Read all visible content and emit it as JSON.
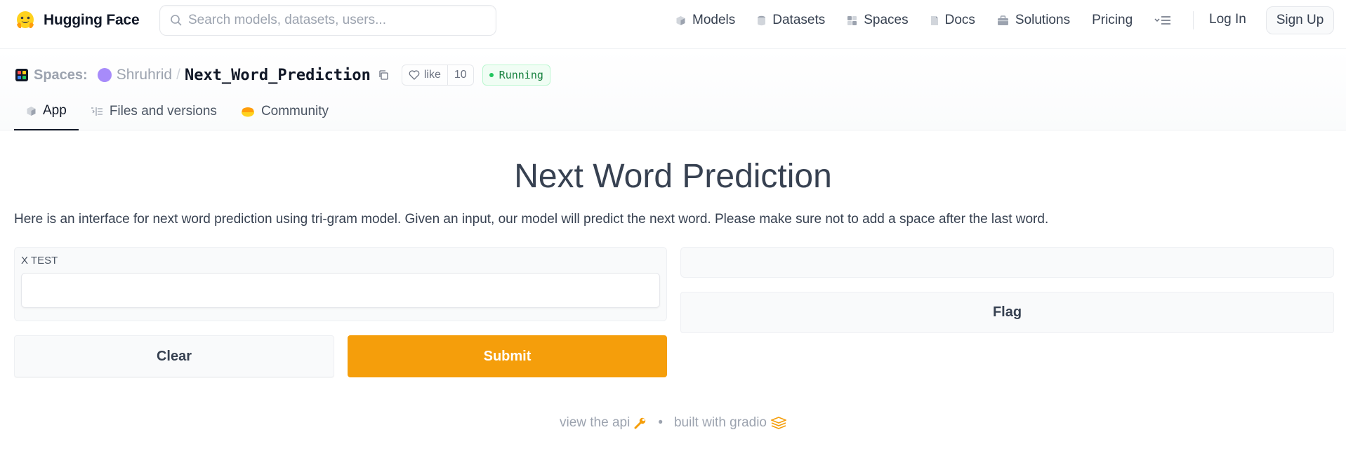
{
  "brand": {
    "name": "Hugging Face"
  },
  "search": {
    "placeholder": "Search models, datasets, users..."
  },
  "nav": {
    "items": [
      {
        "label": "Models",
        "icon": "cube-icon"
      },
      {
        "label": "Datasets",
        "icon": "database-icon"
      },
      {
        "label": "Spaces",
        "icon": "spaces-icon"
      },
      {
        "label": "Docs",
        "icon": "doc-icon"
      },
      {
        "label": "Solutions",
        "icon": "briefcase-icon"
      },
      {
        "label": "Pricing",
        "icon": ""
      }
    ],
    "login": "Log In",
    "signup": "Sign Up"
  },
  "space": {
    "section": "Spaces:",
    "owner": "Shruhrid",
    "separator": "/",
    "name": "Next_Word_Prediction",
    "like_label": "like",
    "like_count": "10",
    "status": "Running"
  },
  "tabs": [
    {
      "label": "App",
      "icon": "cube-icon",
      "active": true
    },
    {
      "label": "Files and versions",
      "icon": "files-icon",
      "active": false
    },
    {
      "label": "Community",
      "icon": "community-icon",
      "active": false
    }
  ],
  "app": {
    "title": "Next Word Prediction",
    "description": "Here is an interface for next word prediction using tri-gram model. Given an input, our model will predict the next word. Please make sure not to add a space after the last word.",
    "input_label": "X TEST",
    "input_value": "",
    "clear_label": "Clear",
    "submit_label": "Submit",
    "flag_label": "Flag",
    "output_value": ""
  },
  "footer": {
    "api": "view the api",
    "separator": "•",
    "built": "built with gradio"
  },
  "colors": {
    "accent": "#f59e0b",
    "status_green": "#22c55e"
  }
}
